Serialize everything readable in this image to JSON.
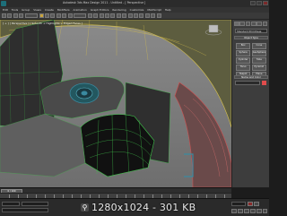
{
  "window": {
    "title": "Autodesk 3ds Max Design 2011 - Untitled - [ Perspective ]"
  },
  "menu": [
    "Edit",
    "Tools",
    "Group",
    "Views",
    "Create",
    "Modifiers",
    "Animation",
    "Graph Editors",
    "Rendering",
    "Customize",
    "MAXScript",
    "Help"
  ],
  "viewport": {
    "label": "[ + ] [ Perspective ] [ Smooth + Highlights + Edged Faces ]",
    "colors": {
      "background": "#7a7a7a",
      "wire_green": "#3fbf4a",
      "wire_yellow": "#d8c24c",
      "accent_teal": "#3a8aa0",
      "accent_red": "#d05050"
    }
  },
  "command_panel": {
    "tabs": [
      "create",
      "modify",
      "hierarchy",
      "motion",
      "display",
      "utilities"
    ],
    "category": "Standard Primitives",
    "rollout_object_type": "Object Type",
    "auto_grid": "AutoGrid",
    "buttons": [
      "Box",
      "Cone",
      "Sphere",
      "GeoSphere",
      "Cylinder",
      "Tube",
      "Torus",
      "Pyramid",
      "Teapot",
      "Plane"
    ],
    "rollout_name_color": "Name and Color",
    "swatch_color": "#e04c4c"
  },
  "timeline": {
    "frame_readout": "0 / 100"
  },
  "watermark": {
    "text": "1280x1024 - 301 KB"
  }
}
